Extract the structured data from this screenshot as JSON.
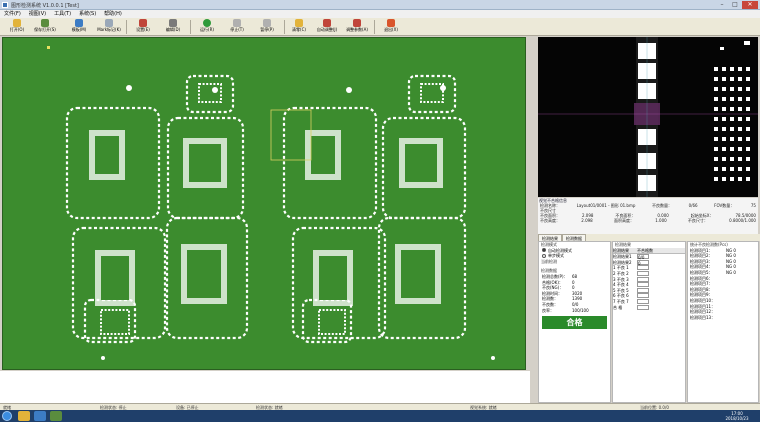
{
  "window": {
    "title": "图形检测系统 V1.0.0.1 [Test]",
    "min": "–",
    "max": "□",
    "close": "✕"
  },
  "menu": [
    "文件(F)",
    "视图(V)",
    "工具(T)",
    "系统(S)",
    "帮助(H)"
  ],
  "toolbar": [
    {
      "label": "打开(O)",
      "icon": "folder-icon",
      "color": "#e2b33a"
    },
    {
      "label": "保存打开(S)",
      "icon": "save-icon",
      "color": "#5a8c3e"
    },
    {
      "label": "模板(M)",
      "icon": "template-icon",
      "color": "#3c7cc4"
    },
    {
      "label": "Mark标记(K)",
      "icon": "mark-icon",
      "color": "#9aa8b8"
    },
    {
      "label": "设置(E)",
      "icon": "settings-icon",
      "color": "#c0453a"
    },
    {
      "label": "编辑(D)",
      "icon": "edit-icon",
      "color": "#7a7a7a"
    },
    {
      "label": "运行(R)",
      "icon": "run-icon",
      "color": "#2e9a3a"
    },
    {
      "label": "停止(T)",
      "icon": "stop-icon",
      "color": "#b0b0b0"
    },
    {
      "label": "暂停(P)",
      "icon": "pause-icon",
      "color": "#b0b0b0"
    },
    {
      "label": "清零(C)",
      "icon": "clear-icon",
      "color": "#e2b33a"
    },
    {
      "label": "自动调整(J)",
      "icon": "adjust-icon",
      "color": "#c0453a"
    },
    {
      "label": "调整参数(A)",
      "icon": "params-icon",
      "color": "#c0453a"
    },
    {
      "label": "退出(X)",
      "icon": "exit-icon",
      "color": "#d9552b"
    }
  ],
  "detail": {
    "caption": "视觉不合格信息",
    "rows": [
      [
        "检测名称：",
        "Layout01/0001 - 图形 01.bmp",
        "不良数量：",
        "0/66",
        "FOV数量：",
        "75"
      ],
      [
        "不良尺寸",
        "",
        "",
        "",
        "",
        ""
      ],
      [
        "不良面积：",
        "2.098",
        "不良面积：",
        "0.000",
        "起始坐标X：",
        "78.5/0000"
      ],
      [
        "不良高度：",
        "2.098",
        "面积高度：",
        "1.000",
        "不良尺寸：",
        "0.8000/1.000"
      ]
    ]
  },
  "tabs": [
    "检测结果",
    "检测数据"
  ],
  "panel_a": {
    "header": "检测模式",
    "options": [
      {
        "label": "自动检测模式",
        "selected": true
      },
      {
        "label": "单步模式",
        "selected": false
      }
    ],
    "sub": "当前检测",
    "stats_header": "检测数据",
    "stats": [
      [
        "检测总数(P)：",
        "68"
      ],
      [
        "合格(OK)：",
        "0"
      ],
      [
        "不良(NG)：",
        "0"
      ],
      [
        "检测时间：",
        "3020"
      ],
      [
        "检测数：",
        "1390"
      ],
      [
        "不良数：",
        "0/0"
      ],
      [
        "良率：",
        "100/100"
      ]
    ],
    "result": "合格"
  },
  "panel_b": {
    "header": "检测结果",
    "cols": [
      "检测结果",
      "不合格数"
    ],
    "rows": [
      "检测结果1",
      "检测结果2",
      "1 不良 1",
      "2 不良 2",
      "3 不良 3",
      "4 不良 4",
      "5 不良 5",
      "6 不良 6",
      "7 不良 7",
      "合 格"
    ],
    "values": [
      "0/0",
      "0",
      "",
      "",
      "",
      "",
      "",
      "",
      "",
      ""
    ]
  },
  "panel_c": {
    "header": "统计不良检测数(Pcs)",
    "rows": [
      [
        "检测项目1：",
        "NG 0"
      ],
      [
        "检测项目2：",
        "NG 0"
      ],
      [
        "检测项目3：",
        "NG 0"
      ],
      [
        "检测项目4：",
        "NG 0"
      ],
      [
        "检测项目5：",
        "NG 0"
      ],
      [
        "检测项目6：",
        ""
      ],
      [
        "检测项目7：",
        ""
      ],
      [
        "检测项目8：",
        ""
      ],
      [
        "检测项目9：",
        ""
      ],
      [
        "检测项目10：",
        ""
      ],
      [
        "检测项目11：",
        ""
      ],
      [
        "检测项目12：",
        ""
      ],
      [
        "检测项目13：",
        ""
      ]
    ]
  },
  "status": [
    "就绪",
    "检测状态: 停止",
    "设备: 已停止",
    "检测状态: 就绪",
    "视觉系统: 就绪",
    "当前位置: 0.0/0"
  ],
  "clock": {
    "time": "17:00",
    "date": "2018/10/23"
  },
  "colors": {
    "board": "#3c8c2e",
    "pass": "#2a8a2a",
    "accent": "#c8463a"
  }
}
